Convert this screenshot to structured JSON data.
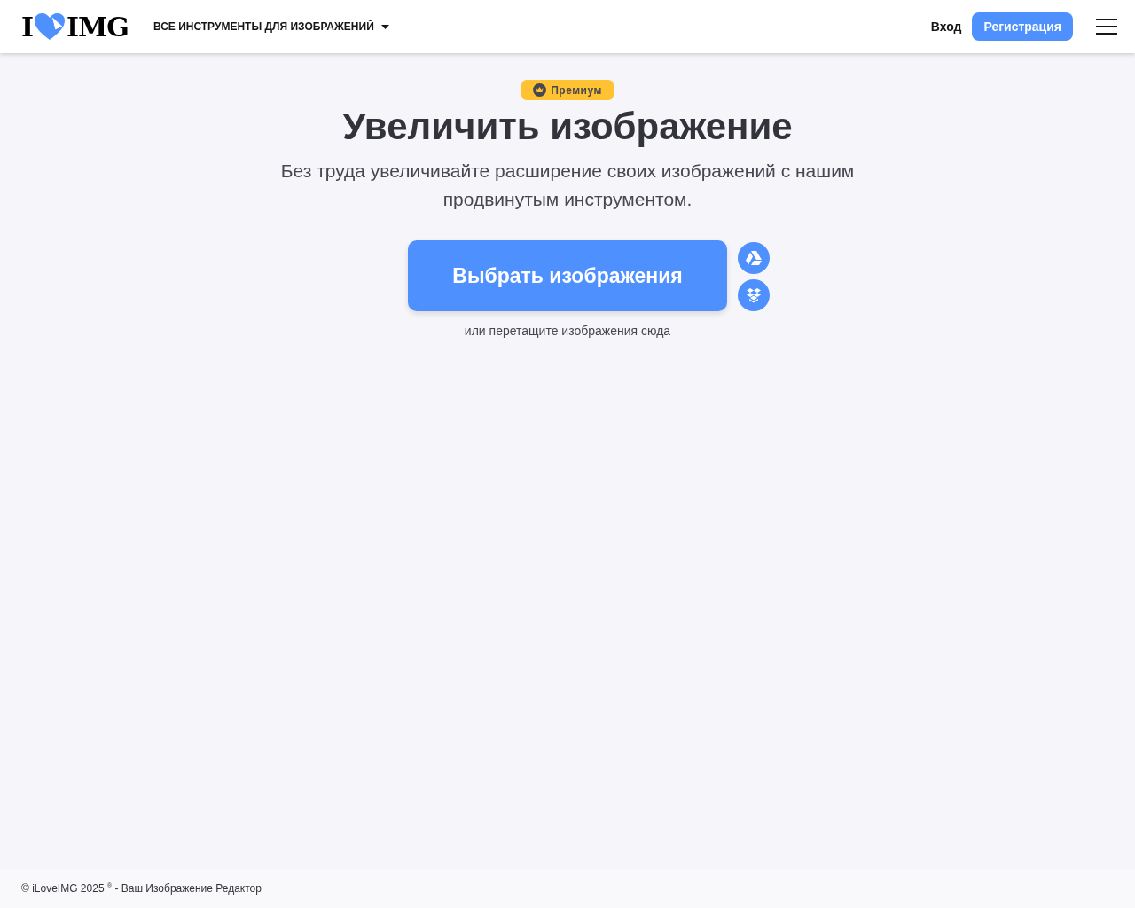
{
  "header": {
    "logo": {
      "left": "I",
      "right": "IMG"
    },
    "tools_menu": {
      "label": "ВСЕ ИНСТРУМЕНТЫ ДЛЯ ИЗОБРАЖЕНИЙ",
      "expanded": false
    },
    "login": "Вход",
    "signup": "Регистрация"
  },
  "hero": {
    "badge": "Премиум",
    "title": "Увеличить изображение",
    "subtitle": "Без труда увеличивайте расширение своих изображений с нашим продвинутым инструментом.",
    "upload_button": "Выбрать изображения",
    "cloud_sources": [
      {
        "kind": "drive"
      },
      {
        "kind": "dropbox"
      }
    ],
    "drop_hint": "или перетащите изображения сюда"
  },
  "footer": {
    "text": "© iLoveIMG 2025 $^{®}$ - Ваш Изображение Редактор"
  }
}
